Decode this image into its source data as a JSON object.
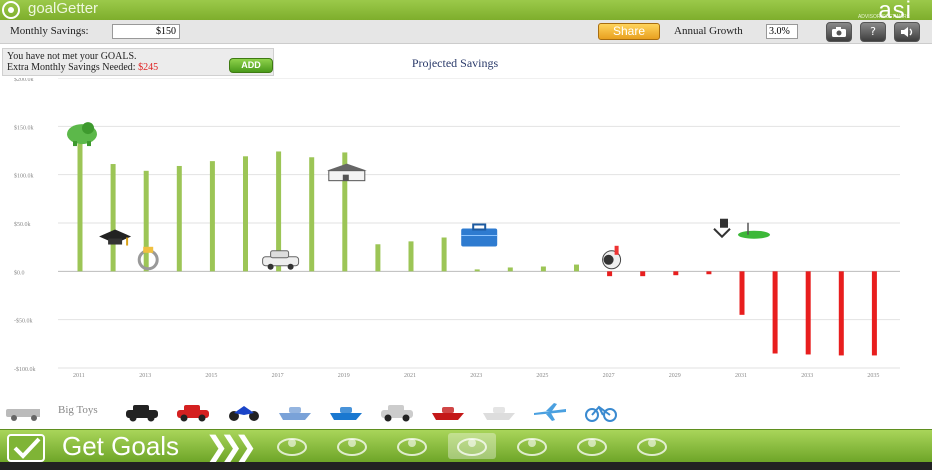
{
  "app": {
    "name": "goalGetter",
    "brand": "asi",
    "brand_sub": "ADVISOR SOFTWARE"
  },
  "controls": {
    "monthly_savings_label": "Monthly Savings:",
    "monthly_savings_value": "$150",
    "share_label": "Share",
    "annual_growth_label": "Annual Growth",
    "annual_growth_value": "3.0%",
    "tool_icons": [
      "camera-icon",
      "help-icon",
      "sound-icon"
    ]
  },
  "goals_message": {
    "line1": "You have not met your GOALS.",
    "line2_label": "Extra Monthly Savings Needed:",
    "line2_amount": "$245",
    "add_label": "ADD"
  },
  "chart_title": "Projected Savings",
  "chart_data": {
    "type": "bar",
    "title": "Projected Savings",
    "ylim": [
      -100,
      200
    ],
    "y_ticks": [
      -100,
      -50,
      0,
      50,
      100,
      150,
      200
    ],
    "y_tick_labels": [
      "-$100.0k",
      "-$50.0k",
      "$0.0",
      "$50.0k",
      "$100.0k",
      "$150.0k",
      "$200.0k"
    ],
    "x_tick_labels": [
      "2011",
      "2013",
      "2015",
      "2017",
      "2019",
      "2021",
      "2023",
      "2025",
      "2027",
      "2029",
      "2031",
      "2033",
      "2035"
    ],
    "categories": [
      "2011",
      "2012",
      "2013",
      "2014",
      "2015",
      "2016",
      "2017",
      "2018",
      "2019",
      "2020",
      "2021",
      "2022",
      "2023",
      "2024",
      "2025",
      "2026",
      "2027",
      "2028",
      "2029",
      "2030",
      "2031",
      "2032",
      "2033",
      "2034",
      "2035"
    ],
    "values": [
      132,
      111,
      104,
      109,
      114,
      119,
      124,
      118,
      123,
      28,
      31,
      35,
      2,
      4,
      5,
      7,
      -5,
      -5,
      -4,
      -3,
      -45,
      -85,
      -86,
      -87,
      -87
    ],
    "colors": {
      "positive": "#9cc556",
      "negative": "#e81e1e"
    },
    "grid": true,
    "goal_icons": [
      {
        "year": "2011",
        "icon": "piggy-bank-icon",
        "value": 142
      },
      {
        "year": "2012",
        "icon": "graduation-cap-icon",
        "value": 36
      },
      {
        "year": "2013",
        "icon": "wedding-ring-icon",
        "value": 14
      },
      {
        "year": "2017",
        "icon": "car-icon",
        "value": 12
      },
      {
        "year": "2019",
        "icon": "house-icon",
        "value": 100
      },
      {
        "year": "2023",
        "icon": "toolbox-icon",
        "value": 35
      },
      {
        "year": "2027",
        "icon": "baby-icon",
        "value": 14
      },
      {
        "year": "2031",
        "icon": "retirement-icon",
        "value": 42
      }
    ]
  },
  "toys": {
    "label": "Big Toys",
    "items": [
      "rv-icon",
      "sports-car-icon",
      "red-car-icon",
      "motorcycle-icon",
      "speedboat-icon",
      "blue-boat-icon",
      "suv-icon",
      "jet-ski-icon",
      "yacht-icon",
      "airplane-icon",
      "bicycle-icon"
    ]
  },
  "bottom": {
    "get_goals_label": "Get Goals",
    "categories": [
      "baby-stroller-icon",
      "tools-icon",
      "umbrella-icon",
      "car-category-icon",
      "ring-category-icon",
      "graduation-category-icon",
      "piggy-bank-category-icon"
    ]
  }
}
